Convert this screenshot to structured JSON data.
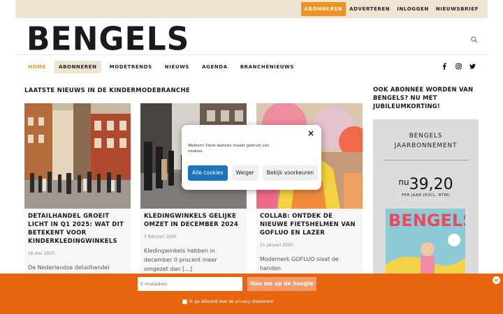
{
  "topbar": {
    "links": [
      {
        "label": "ABONNEREN",
        "active": true
      },
      {
        "label": "ADVERTEREN",
        "active": false
      },
      {
        "label": "INLOGGEN",
        "active": false
      },
      {
        "label": "NIEUWSBRIEF",
        "active": false
      }
    ]
  },
  "logo": {
    "text": "BENGELS"
  },
  "nav": {
    "items": [
      {
        "label": "HOME",
        "style": "home"
      },
      {
        "label": "ABONNEREN",
        "style": "sub"
      },
      {
        "label": "MODETRENDS",
        "style": ""
      },
      {
        "label": "NIEUWS",
        "style": ""
      },
      {
        "label": "AGENDA",
        "style": ""
      },
      {
        "label": "BRANCHENIEUWS",
        "style": ""
      }
    ],
    "social_icons": [
      "facebook-icon",
      "instagram-icon",
      "twitter-icon"
    ]
  },
  "main": {
    "section_title": "LAATSTE NIEUWS IN DE KINDERMODEBRANCHE",
    "cards": [
      {
        "title": "DETAILHANDEL GROEIT LICHT IN Q1 2025: WAT DIT BETEKENT VOOR KINDERKLEDINGWINKELS",
        "date": "16 mei 2025",
        "excerpt": "De Nederlandse detailhandel"
      },
      {
        "title": "KLEDINGWINKELS GELIJKE OMZET IN DECEMBER 2024",
        "date": "3 februari 2025",
        "excerpt": "Kledingwinkels hebben in december 0 procent meer omgezet dan [...]"
      },
      {
        "title": "COLLAB: ONTDEK DE NIEUWE FIETSHELMEN VAN GOFLUO EN LAZER",
        "date": "21 januari 2025",
        "excerpt": "Modemerk GOFLUO slaat de handen"
      }
    ]
  },
  "sidebar": {
    "title": "OOK ABONNEE WORDEN VAN BENGELS? NU MET JUBILEUMKORTING!",
    "box_title_1": "BENGELS",
    "box_title_2": "JAARBONNEMENT",
    "price_prefix": "nu",
    "price": "39,20",
    "per": "PER JAAR (EXCL. BTW)",
    "cover_title": "BENGELS"
  },
  "cookie_modal": {
    "message": "Welkom! Deze website maakt gebruik van cookies.",
    "accept": "Alle cookies",
    "decline": "Weiger",
    "prefs": "Bekijk voorkeuren",
    "close": "×"
  },
  "newsletter_bar": {
    "email_placeholder": "E-mailadres",
    "button": "Hou me op de hoogte",
    "privacy": "Ik ga akkoord met de privacy statement",
    "close": "×"
  },
  "colors": {
    "accent": "#f0931e",
    "topbar_bg": "#efe4d2",
    "footer_bg": "#e8650f",
    "modal_primary": "#1e73be"
  }
}
